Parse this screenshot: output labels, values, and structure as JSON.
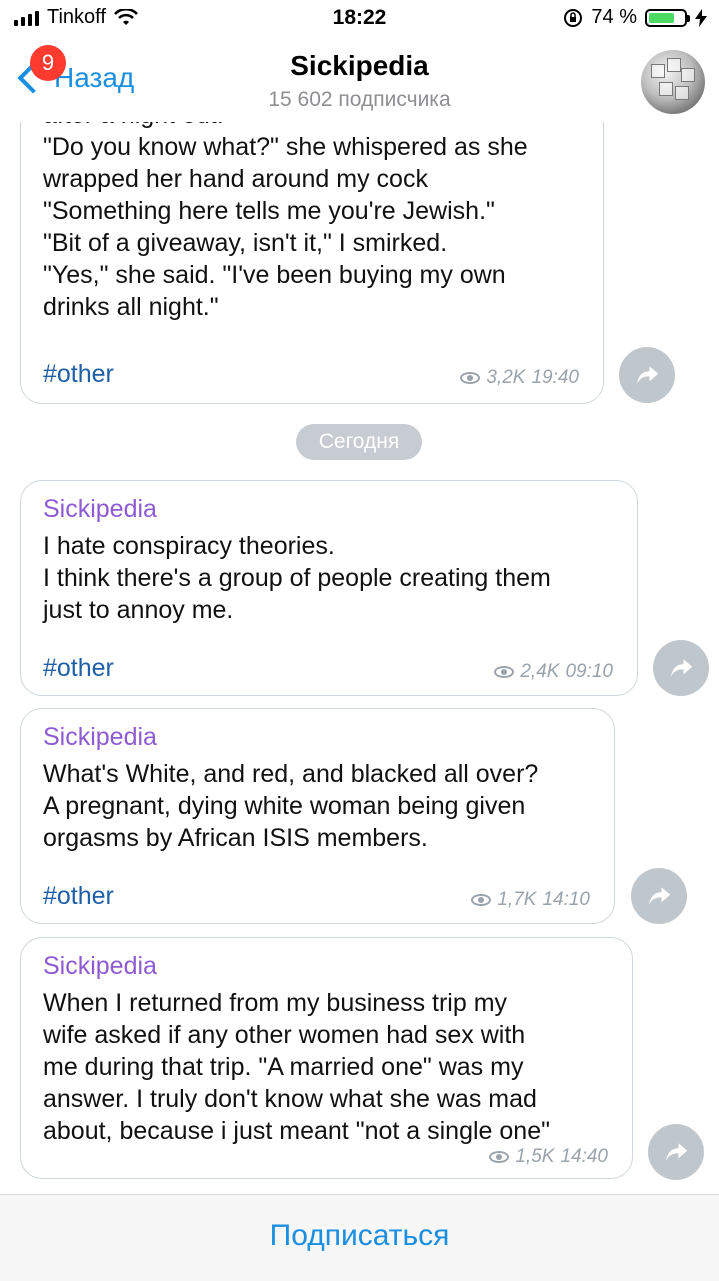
{
  "status_bar": {
    "carrier": "Tinkoff",
    "time": "18:22",
    "battery_percent": "74 %",
    "battery_level": 0.74
  },
  "nav": {
    "back_label": "Назад",
    "badge_count": "9",
    "title": "Sickipedia",
    "subtitle": "15 602 подписчика",
    "avatar_icon": "wikipedia-globe-icon"
  },
  "messages": [
    {
      "author": "",
      "text": "after a night out.\n\"Do you know what?\" she whispered as she\nwrapped her hand around my cock\n\"Something here tells me you're Jewish.\"\n\"Bit of a giveaway, isn't it,\" I smirked.\n\"Yes,\" she said. \"I've been buying my own\ndrinks all night.\"",
      "tag": "#other",
      "views": "3,2K",
      "time": "19:40"
    },
    {
      "author": "Sickipedia",
      "text": "I hate conspiracy theories.\nI think there's a group of people creating them\njust to annoy me.",
      "tag": "#other",
      "views": "2,4K",
      "time": "09:10"
    },
    {
      "author": "Sickipedia",
      "text": "What's White, and red, and blacked all over?\nA pregnant, dying white woman being given\norgasms by African ISIS members.",
      "tag": "#other",
      "views": "1,7K",
      "time": "14:10"
    },
    {
      "author": "Sickipedia",
      "text": "When I returned from my business trip my\nwife asked if any other women had sex with\nme during that trip. \"A married one\" was my\nanswer. I truly don't know what she was mad\nabout, because i just meant \"not a single one\"",
      "tag": "",
      "views": "1,5K",
      "time": "14:40"
    }
  ],
  "date_divider": "Сегодня",
  "footer": {
    "subscribe_label": "Подписаться"
  },
  "colors": {
    "accent": "#1a8ee1",
    "author": "#8e5bd4",
    "hashtag": "#1f5fa8",
    "badge": "#ff3b30",
    "battery": "#4cd964"
  }
}
